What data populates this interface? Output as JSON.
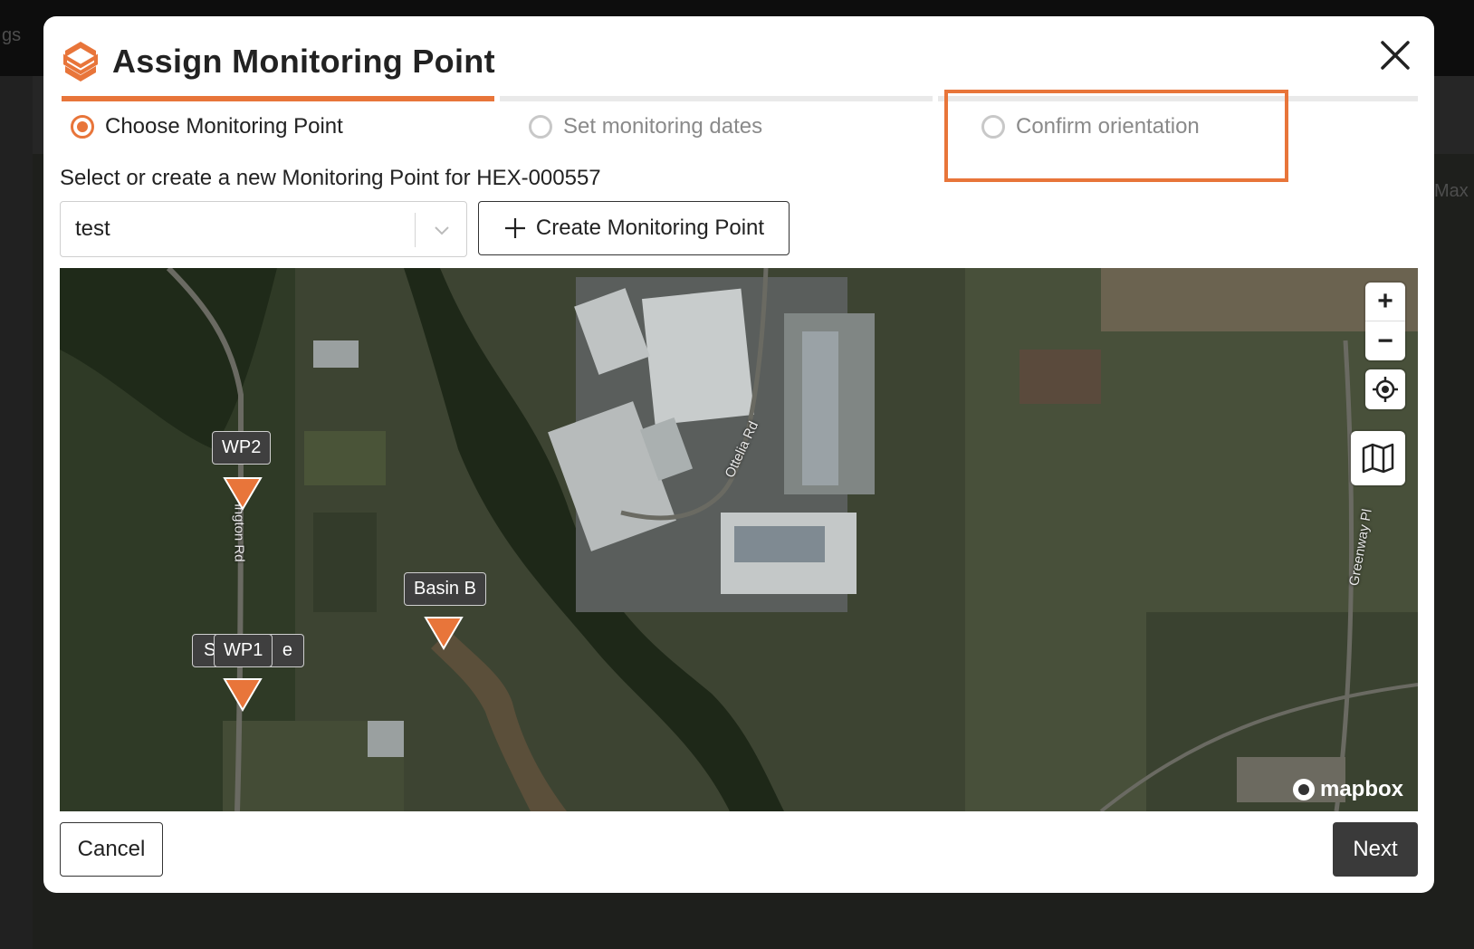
{
  "background": {
    "topbar_fragment": "gs",
    "side_fragment": "Max"
  },
  "modal": {
    "title": "Assign Monitoring Point",
    "logo_icon": "brand-s-logo-icon",
    "close_icon": "close-icon",
    "steps": [
      {
        "label": "Choose Monitoring Point",
        "state": "active"
      },
      {
        "label": "Set monitoring dates",
        "state": "inactive"
      },
      {
        "label": "Confirm orientation",
        "state": "inactive"
      }
    ],
    "instruction": "Select or create a new Monitoring Point for HEX-000557",
    "select": {
      "value": "test",
      "icon": "chevron-down-icon"
    },
    "create_button": {
      "label": "Create Monitoring Point",
      "icon": "plus-icon"
    },
    "map": {
      "markers": [
        {
          "label": "WP2"
        },
        {
          "label": "Basin B"
        },
        {
          "label": "WP1"
        },
        {
          "label_hidden_left": "S",
          "label_hidden_right": "e"
        }
      ],
      "road_labels": [
        "Ottelia Rd",
        "Greenway Pl",
        "ington Rd"
      ],
      "controls": {
        "zoom_in": "+",
        "zoom_out": "−"
      },
      "attribution": "mapbox"
    },
    "footer": {
      "cancel_label": "Cancel",
      "next_label": "Next"
    },
    "colors": {
      "accent": "#e8753a",
      "primary_dark": "#3a3a3a"
    }
  }
}
